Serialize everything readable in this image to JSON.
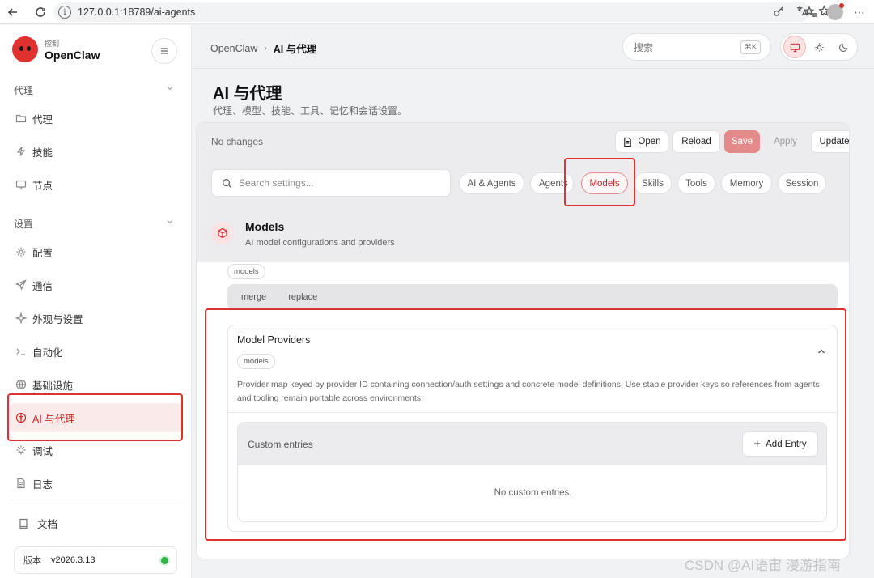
{
  "browser": {
    "url": "127.0.0.1:18789/ai-agents"
  },
  "sidebar": {
    "brand_sub": "控制",
    "brand_name": "OpenClaw",
    "section_agent": "代理",
    "items_agent": [
      {
        "label": "代理",
        "icon": "folder-icon"
      },
      {
        "label": "技能",
        "icon": "bolt-icon"
      },
      {
        "label": "节点",
        "icon": "monitor-icon"
      }
    ],
    "section_settings": "设置",
    "items_settings": [
      {
        "label": "配置",
        "icon": "gear-icon"
      },
      {
        "label": "通信",
        "icon": "send-icon"
      },
      {
        "label": "外观与设置",
        "icon": "sparkle-icon"
      },
      {
        "label": "自动化",
        "icon": "terminal-icon"
      },
      {
        "label": "基础设施",
        "icon": "globe-icon"
      },
      {
        "label": "AI 与代理",
        "icon": "brain-icon",
        "active": true
      },
      {
        "label": "调试",
        "icon": "bug-icon"
      },
      {
        "label": "日志",
        "icon": "file-icon"
      }
    ],
    "docs": "文档",
    "version_label": "版本",
    "version": "v2026.3.13"
  },
  "topbar": {
    "breadcrumb_root": "OpenClaw",
    "breadcrumb_sep": "›",
    "breadcrumb_current": "AI 与代理",
    "search_placeholder": "搜索",
    "search_shortcut": "⌘K"
  },
  "page": {
    "title": "AI 与代理",
    "subtitle": "代理、模型、技能、工具、记忆和会话设置。"
  },
  "settings": {
    "status": "No changes",
    "actions": {
      "open": "Open",
      "reload": "Reload",
      "save": "Save",
      "apply": "Apply",
      "update": "Update"
    },
    "search_placeholder": "Search settings...",
    "tabs": [
      "AI & Agents",
      "Agents",
      "Models",
      "Skills",
      "Tools",
      "Memory",
      "Session"
    ],
    "active_tab": "Models",
    "section": {
      "title": "Models",
      "description": "AI model configurations and providers"
    },
    "mode_tag": "models",
    "mode_options": [
      "merge",
      "replace"
    ],
    "providers": {
      "title": "Model Providers",
      "tag": "models",
      "description": "Provider map keyed by provider ID containing connection/auth settings and concrete model definitions. Use stable provider keys so references from agents and tooling remain portable across environments.",
      "custom_label": "Custom entries",
      "add_entry": "Add Entry",
      "empty": "No custom entries."
    }
  },
  "watermark": "CSDN @AI语宙 漫游指南",
  "colors": {
    "accent": "#e03131",
    "save": "#e58a8a",
    "status_ok": "#2fb344"
  }
}
